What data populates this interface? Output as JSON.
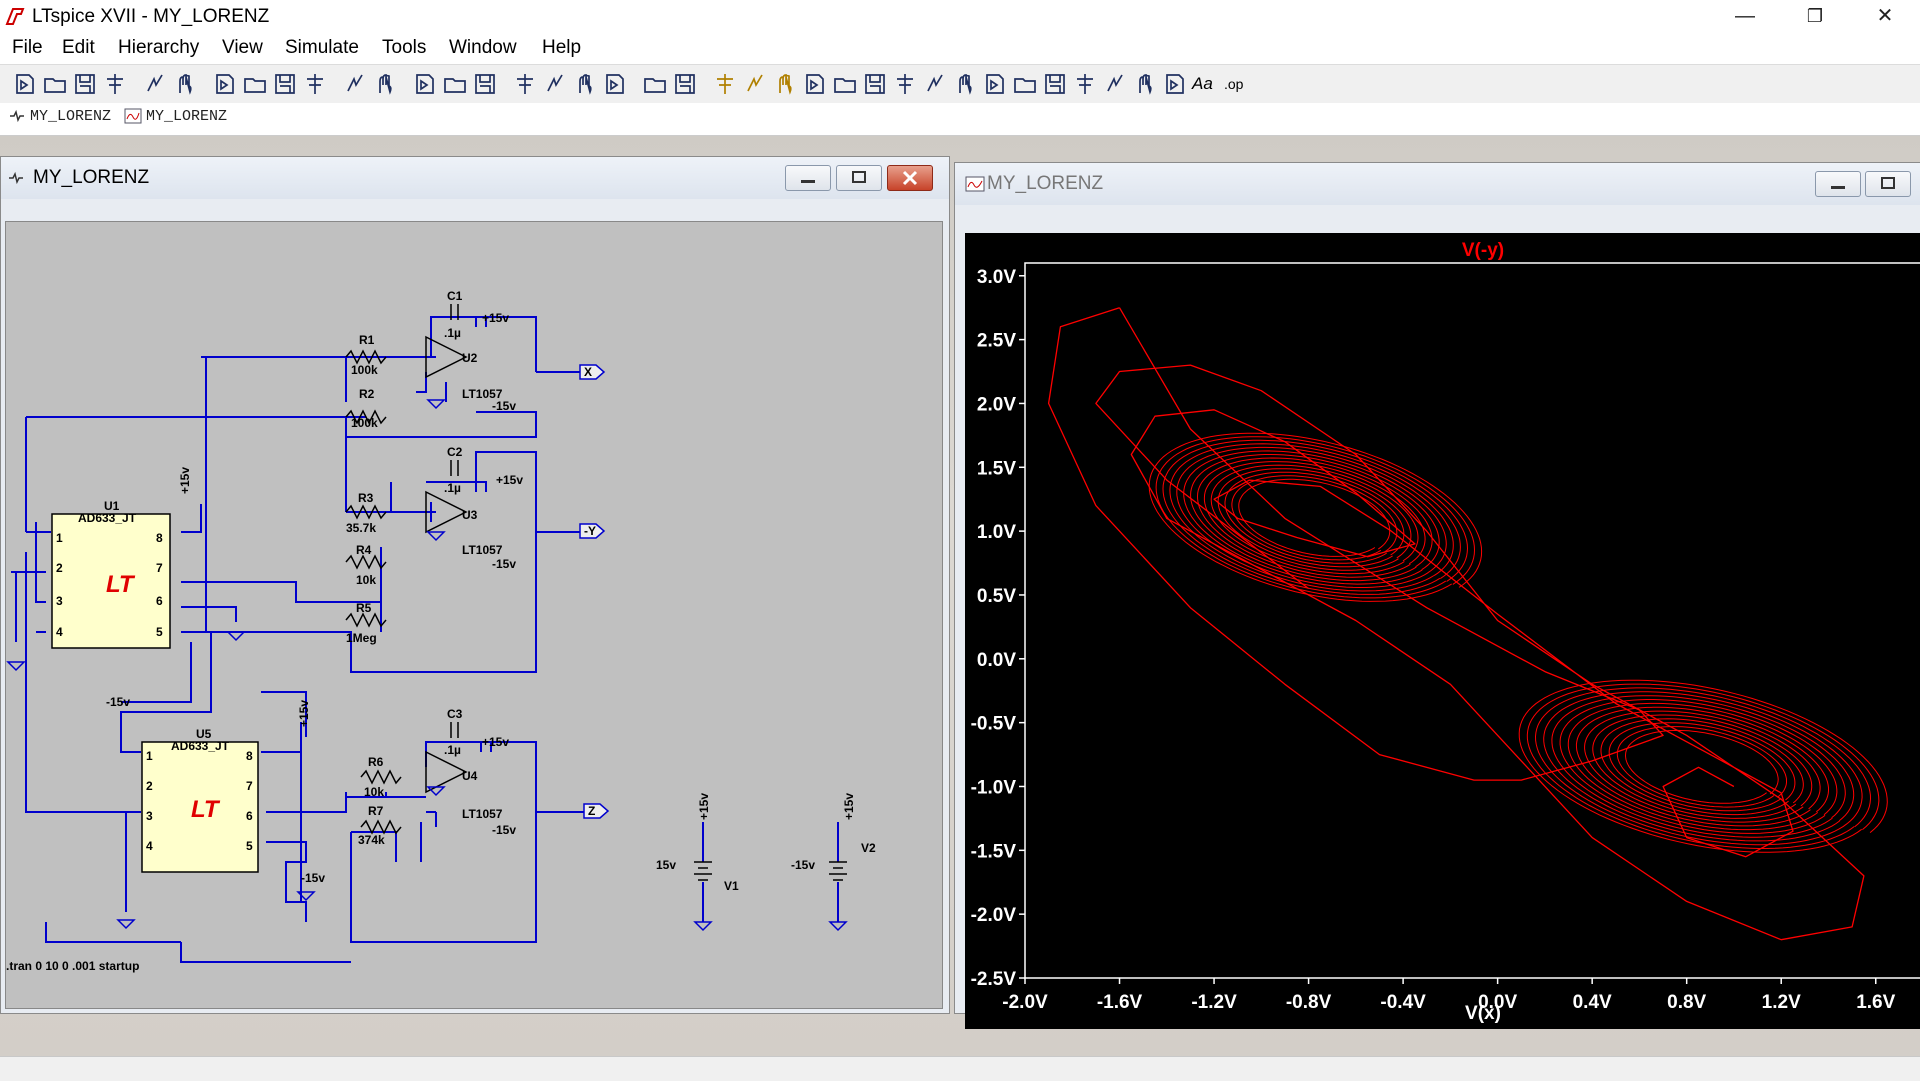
{
  "window": {
    "title": "LTspice XVII - MY_LORENZ",
    "minimize": "—",
    "maximize": "❐",
    "close": "✕"
  },
  "menu": [
    "File",
    "Edit",
    "Hierarchy",
    "View",
    "Simulate",
    "Tools",
    "Window",
    "Help"
  ],
  "menu_mnemonics": [
    "F",
    "E",
    "H",
    "V",
    "S",
    "T",
    "W",
    "H"
  ],
  "toolbar_icons": [
    "new-schematic-icon",
    "open-icon",
    "save-icon",
    "control-panel-icon",
    "run-icon",
    "halt-icon",
    "zoom-in-icon",
    "zoom-extent-icon",
    "zoom-out-icon",
    "zoom-cancel-icon",
    "autorange-icon",
    "grid-icon",
    "tile-horizontal-icon",
    "cascade-icon",
    "tile-vertical-icon",
    "cut-icon",
    "copy-icon",
    "paste-icon",
    "find-icon",
    "print-icon",
    "print-preview-icon",
    "draw-wire-icon",
    "ground-icon",
    "label-net-icon",
    "resistor-icon",
    "capacitor-icon",
    "inductor-icon",
    "diode-icon",
    "component-icon",
    "move-icon",
    "drag-icon",
    "undo-icon",
    "redo-icon",
    "rotate-icon",
    "mirror-icon",
    "text-icon",
    "spice-directive-icon"
  ],
  "toolbar_text": {
    "text_icon": "Aa",
    "op_icon": ".op"
  },
  "tabs": [
    {
      "label": "MY_LORENZ",
      "icon": "schematic-icon"
    },
    {
      "label": "MY_LORENZ",
      "icon": "waveform-icon"
    }
  ],
  "schematic_window": {
    "title": "MY_LORENZ"
  },
  "plot_window": {
    "title": "MY_LORENZ"
  },
  "schematic": {
    "labels": {
      "c1": "C1",
      "c1v": ".1µ",
      "c2": "C2",
      "c2v": ".1µ",
      "c3": "C3",
      "c3v": ".1µ",
      "r1": "R1",
      "r1v": "100k",
      "r2": "R2",
      "r2v": "100k",
      "r3": "R3",
      "r3v": "35.7k",
      "r4": "R4",
      "r4v": "10k",
      "r5": "R5",
      "r5v": "1Meg",
      "r6": "R6",
      "r6v": "10k",
      "r7": "R7",
      "r7v": "374k",
      "u2": "U2",
      "u3": "U3",
      "u4": "U4",
      "lt1057": "LT1057",
      "u1": "U1",
      "u5": "U5",
      "ad633": "AD633_JT",
      "p15": "+15v",
      "m15": "-15v",
      "p15b": "15v",
      "m15b": "-15v",
      "v1": "V1",
      "v2": "V2",
      "netx": "X",
      "nety": "-Y",
      "netz": "Z",
      "directive": ".tran 0 10 0 .001 startup",
      "pin1": "1",
      "pin2": "2",
      "pin3": "3",
      "pin4": "4",
      "pin5": "5",
      "pin6": "6",
      "pin7": "7",
      "pin8": "8"
    }
  },
  "chart_data": {
    "type": "line",
    "title": "V(-y)",
    "xlabel": "V(x)",
    "ylabel": "",
    "xlim": [
      -2.0,
      1.8
    ],
    "ylim": [
      -2.5,
      3.1
    ],
    "x_ticks": [
      "-2.0V",
      "-1.6V",
      "-1.2V",
      "-0.8V",
      "-0.4V",
      "0.0V",
      "0.4V",
      "0.8V",
      "1.2V",
      "1.6V"
    ],
    "y_ticks": [
      "3.0V",
      "2.5V",
      "2.0V",
      "1.5V",
      "1.0V",
      "0.5V",
      "0.0V",
      "-0.5V",
      "-1.0V",
      "-1.5V",
      "-2.0V",
      "-2.5V"
    ],
    "series": [
      {
        "name": "V(-y)",
        "color": "#ff0000",
        "x": [
          -0.8,
          -1.4,
          -1.7,
          -1.6,
          -1.3,
          -1.0,
          -0.6,
          -0.3,
          0.0,
          0.4,
          0.8,
          1.2,
          1.55,
          1.5,
          1.2,
          0.8,
          0.4,
          0.1,
          -0.2,
          -0.6,
          -1.0,
          -1.4,
          -1.55,
          -1.45,
          -1.2,
          -0.9,
          -0.6,
          -0.35,
          -0.55,
          -0.85,
          -1.1,
          -1.2,
          -1.05,
          -0.75,
          -0.45,
          0.0,
          0.5,
          0.9,
          1.2,
          1.25,
          1.05,
          0.8,
          0.7,
          0.85,
          1.0
        ],
        "y": [
          0.55,
          1.4,
          2.0,
          2.25,
          2.3,
          2.1,
          1.6,
          1.0,
          0.3,
          -0.2,
          -0.6,
          -1.1,
          -1.7,
          -2.1,
          -2.2,
          -1.9,
          -1.4,
          -0.8,
          -0.2,
          0.3,
          0.7,
          1.1,
          1.6,
          1.9,
          1.95,
          1.7,
          1.3,
          0.9,
          0.8,
          0.95,
          1.1,
          1.25,
          1.4,
          1.35,
          1.0,
          0.35,
          -0.35,
          -0.75,
          -1.05,
          -1.35,
          -1.55,
          -1.4,
          -1.0,
          -0.85,
          -1.0
        ]
      },
      {
        "name": "",
        "color": "#ff0000",
        "outer": true,
        "x": [
          -1.6,
          -1.85,
          -1.9,
          -1.7,
          -1.3,
          -0.9,
          -0.5,
          -0.1,
          0.1,
          0.4,
          0.7,
          0.6,
          0.2,
          -0.3,
          -0.9,
          -1.3,
          -1.6
        ],
        "y": [
          2.75,
          2.6,
          2.0,
          1.2,
          0.4,
          -0.2,
          -0.75,
          -0.95,
          -0.95,
          -0.8,
          -0.6,
          -0.4,
          -0.1,
          0.4,
          1.1,
          1.8,
          2.75
        ]
      }
    ]
  },
  "colors": {
    "wire": "#0000cc",
    "ic_fill": "#ffffcc",
    "ic_logo": "#e00000",
    "trace": "#ff0000",
    "plot_bg": "#000000",
    "plot_axes": "#ffffff",
    "schematic_bg": "#c0c0c0"
  }
}
